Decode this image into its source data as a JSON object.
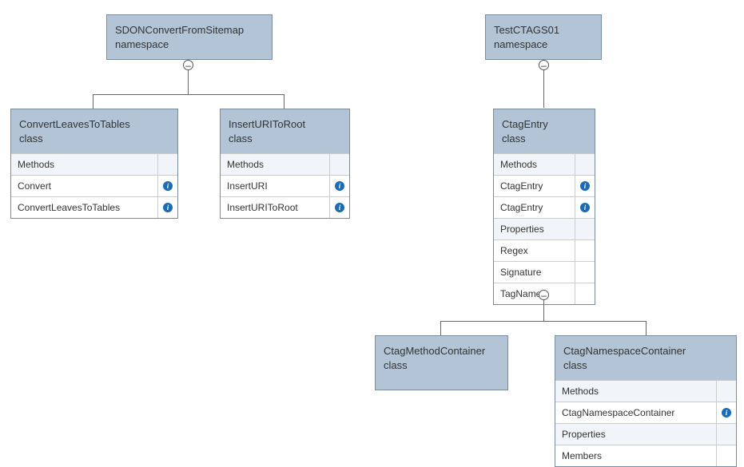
{
  "left_tree": {
    "root": {
      "name": "SDONConvertFromSitemap",
      "kind": "namespace"
    },
    "children": [
      {
        "name": "ConvertLeavesToTables",
        "kind": "class",
        "sections": [
          {
            "label": "Methods",
            "type": "section"
          },
          {
            "label": "Convert",
            "info": true
          },
          {
            "label": "ConvertLeavesToTables",
            "info": true
          }
        ]
      },
      {
        "name": "InsertURIToRoot",
        "kind": "class",
        "sections": [
          {
            "label": "Methods",
            "type": "section"
          },
          {
            "label": "InsertURI",
            "info": true
          },
          {
            "label": "InsertURIToRoot",
            "info": true
          }
        ]
      }
    ]
  },
  "right_tree": {
    "root": {
      "name": "TestCTAGS01",
      "kind": "namespace"
    },
    "child": {
      "name": "CtagEntry",
      "kind": "class",
      "sections": [
        {
          "label": "Methods",
          "type": "section"
        },
        {
          "label": "CtagEntry",
          "info": true
        },
        {
          "label": "CtagEntry",
          "info": true
        },
        {
          "label": "Properties",
          "type": "section"
        },
        {
          "label": "Regex"
        },
        {
          "label": "Signature"
        },
        {
          "label": "TagName"
        }
      ],
      "children": [
        {
          "name": "CtagMethodContainer",
          "kind": "class"
        },
        {
          "name": "CtagNamespaceContainer",
          "kind": "class",
          "sections": [
            {
              "label": "Methods",
              "type": "section"
            },
            {
              "label": "CtagNamespaceContainer",
              "info": true
            },
            {
              "label": "Properties",
              "type": "section"
            },
            {
              "label": "Members"
            }
          ]
        }
      ]
    }
  }
}
